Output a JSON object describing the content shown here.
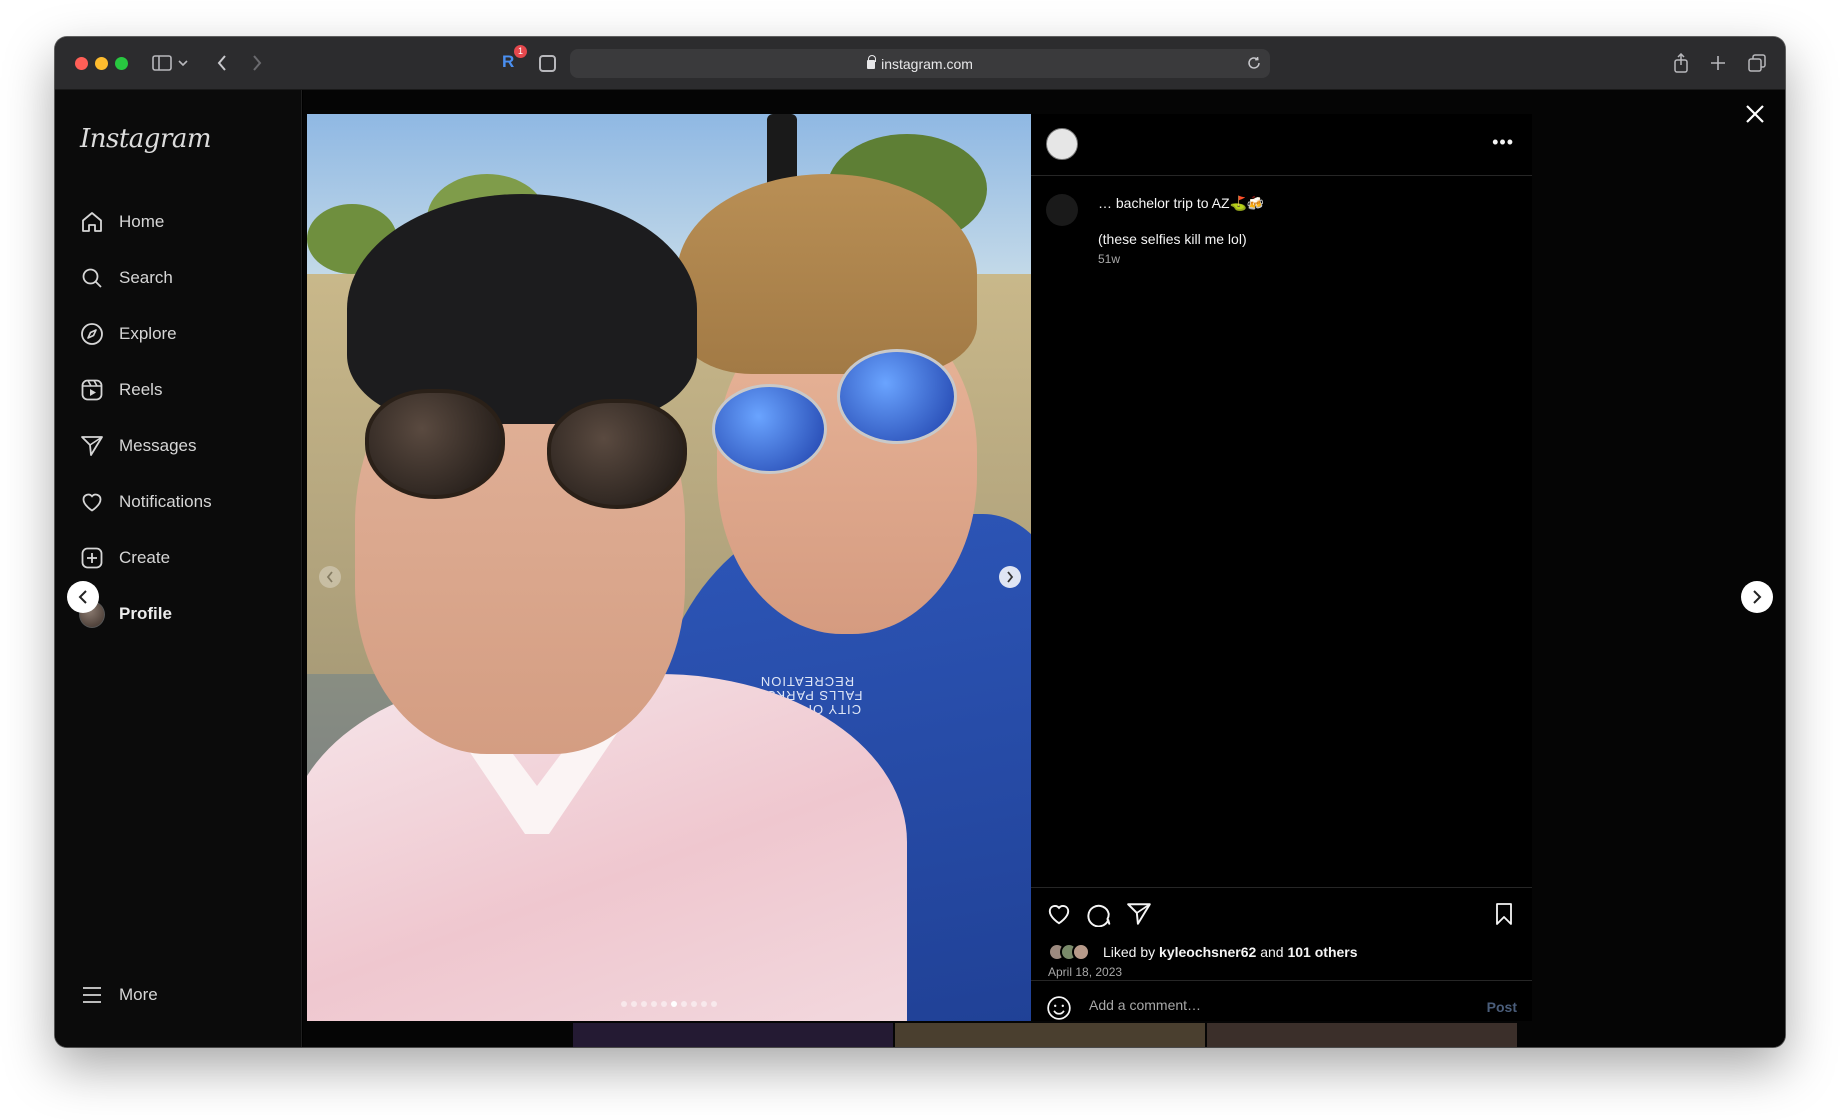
{
  "browser": {
    "url": "instagram.com",
    "extension_badge": "1"
  },
  "sidebar": {
    "logo": "Instagram",
    "items": [
      {
        "label": "Home",
        "icon": "home-icon"
      },
      {
        "label": "Search",
        "icon": "search-icon"
      },
      {
        "label": "Explore",
        "icon": "explore-compass-icon"
      },
      {
        "label": "Reels",
        "icon": "reels-icon"
      },
      {
        "label": "Messages",
        "icon": "messages-send-icon"
      },
      {
        "label": "Notifications",
        "icon": "heart-icon"
      },
      {
        "label": "Create",
        "icon": "create-plus-icon"
      },
      {
        "label": "Profile",
        "icon": "profile-avatar"
      }
    ],
    "more_label": "More"
  },
  "post": {
    "author": "",
    "caption_line1": "… bachelor trip to AZ⛳️🍻",
    "caption_line2": "(these selfies kill me lol)",
    "caption_age": "51w",
    "likes_prefix": "Liked by",
    "liked_by_user": "kyleochsner62",
    "likes_and": "and",
    "likes_others": "101 others",
    "date": "April 18, 2023",
    "comment_placeholder": "Add a comment…",
    "post_button": "Post",
    "shirt_text": "CITY OF SIOUX FALLS PARKS & RECREATION",
    "carousel_total": 10,
    "carousel_active_index": 5
  }
}
